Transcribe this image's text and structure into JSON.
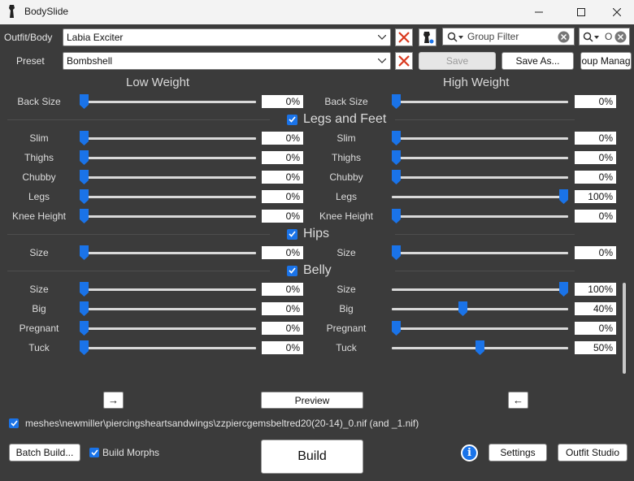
{
  "window": {
    "title": "BodySlide"
  },
  "toolbar": {
    "outfit_label": "Outfit/Body",
    "outfit_value": "Labia Exciter",
    "preset_label": "Preset",
    "preset_value": "Bombshell",
    "group_filter_placeholder": "Group Filter",
    "outfit_filter_value": "O",
    "save_label": "Save",
    "save_as_label": "Save As...",
    "group_manager_label": "oup Manag"
  },
  "columns": {
    "low": "Low Weight",
    "high": "High Weight"
  },
  "sliders": {
    "back_size": {
      "label": "Back Size",
      "low": "0%",
      "high": "0%",
      "low_pct": 0,
      "high_pct": 0
    },
    "slim": {
      "label": "Slim",
      "low": "0%",
      "high": "0%",
      "low_pct": 0,
      "high_pct": 0
    },
    "thighs": {
      "label": "Thighs",
      "low": "0%",
      "high": "0%",
      "low_pct": 0,
      "high_pct": 0
    },
    "chubby": {
      "label": "Chubby",
      "low": "0%",
      "high": "0%",
      "low_pct": 0,
      "high_pct": 0
    },
    "legs": {
      "label": "Legs",
      "low": "0%",
      "high": "100%",
      "low_pct": 0,
      "high_pct": 100
    },
    "knee_height": {
      "label": "Knee Height",
      "low": "0%",
      "high": "0%",
      "low_pct": 0,
      "high_pct": 0
    },
    "hips_size": {
      "label": "Size",
      "low": "0%",
      "high": "0%",
      "low_pct": 0,
      "high_pct": 0
    },
    "belly_size": {
      "label": "Size",
      "low": "0%",
      "high": "100%",
      "low_pct": 0,
      "high_pct": 100
    },
    "big": {
      "label": "Big",
      "low": "0%",
      "high": "40%",
      "low_pct": 0,
      "high_pct": 40
    },
    "pregnant": {
      "label": "Pregnant",
      "low": "0%",
      "high": "0%",
      "low_pct": 0,
      "high_pct": 0
    },
    "tuck": {
      "label": "Tuck",
      "low": "0%",
      "high": "50%",
      "low_pct": 0,
      "high_pct": 50
    }
  },
  "sections": {
    "legs_feet": "Legs and Feet",
    "hips": "Hips",
    "belly": "Belly"
  },
  "preview": {
    "left_arrow": "→",
    "label": "Preview",
    "right_arrow": "←"
  },
  "output": {
    "file_path": "meshes\\newmiller\\piercingsheartsandwings\\zzpiercgemsbeltred20(20-14)_0.nif (and _1.nif)"
  },
  "bottom": {
    "batch_build": "Batch Build...",
    "build_morphs": "Build Morphs",
    "build": "Build",
    "settings": "Settings",
    "outfit_studio": "Outfit Studio",
    "info": "i"
  },
  "colors": {
    "accent": "#1a73e8",
    "background": "#3b3b3b",
    "clear_red": "#d9381e"
  }
}
